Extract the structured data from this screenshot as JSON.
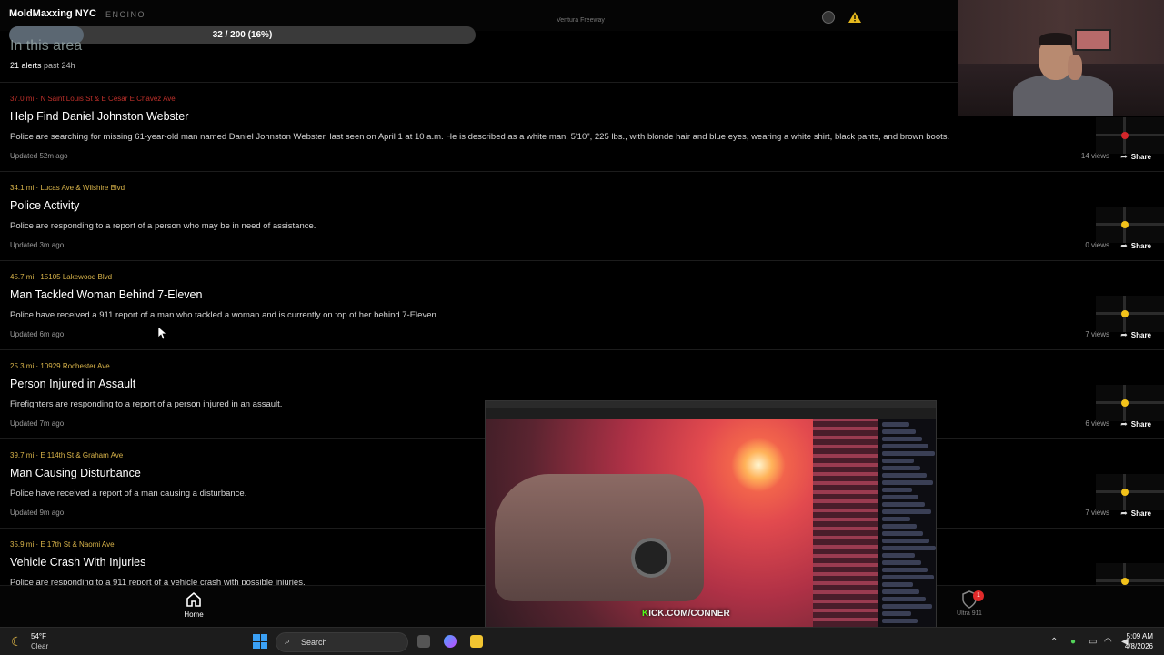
{
  "stream": {
    "title": "MoldMaxxing NYC",
    "area_tag": "ENCINO",
    "freeway_label": "Ventura Freeway",
    "progress": {
      "label": "32 / 200 (16%)",
      "fraction": 0.16
    }
  },
  "header": {
    "title": "In this area",
    "alerts_count": "21 alerts",
    "alerts_window": "past 24h"
  },
  "alerts": [
    {
      "meta": "37.0 mi · N Saint Louis St & E Cesar E Chavez Ave",
      "meta_color": "#c0312b",
      "title": "Help Find Daniel Johnston Webster",
      "description": "Police are searching for missing 61-year-old man named Daniel Johnston Webster, last seen on April 1 at 10 a.m. He is described as a white man, 5'10\", 225 lbs., with blonde hair and blue eyes, wearing a white shirt, black pants, and brown boots.",
      "updated": "Updated 52m ago",
      "views": "14 views",
      "share": "Share",
      "pin_color": "#d3262b"
    },
    {
      "meta": "34.1 mi · Lucas Ave & Wilshire Blvd",
      "meta_color": "#d9b44a",
      "title": "Police Activity",
      "description": "Police are responding to a report of a person who may be in need of assistance.",
      "updated": "Updated 3m ago",
      "views": "0 views",
      "share": "Share",
      "pin_color": "#f2c21a"
    },
    {
      "meta": "45.7 mi · 15105 Lakewood Blvd",
      "meta_color": "#d9b44a",
      "title": "Man Tackled Woman Behind 7-Eleven",
      "description": "Police have received a 911 report of a man who tackled a woman and is currently on top of her behind 7-Eleven.",
      "updated": "Updated 6m ago",
      "views": "7 views",
      "share": "Share",
      "pin_color": "#f2c21a"
    },
    {
      "meta": "25.3 mi · 10929 Rochester Ave",
      "meta_color": "#d9b44a",
      "title": "Person Injured in Assault",
      "description": "Firefighters are responding to a report of a person injured in an assault.",
      "updated": "Updated 7m ago",
      "views": "6 views",
      "share": "Share",
      "pin_color": "#f2c21a"
    },
    {
      "meta": "39.7 mi · E 114th St & Graham Ave",
      "meta_color": "#d9b44a",
      "title": "Man Causing Disturbance",
      "description": "Police have received a report of a man causing a disturbance.",
      "updated": "Updated 9m ago",
      "views": "7 views",
      "share": "Share",
      "pin_color": "#f2c21a"
    },
    {
      "meta": "35.9 mi · E 17th St & Naomi Ave",
      "meta_color": "#d9b44a",
      "title": "Vehicle Crash With Injuries",
      "description": "Police are responding to a 911 report of a vehicle crash with possible injuries.",
      "updated": "",
      "views": "",
      "share": "",
      "pin_color": "#f2c21a"
    }
  ],
  "bottom_nav": {
    "home_label": "Home",
    "ultra_label": "Ultra 911",
    "ultra_badge": "1"
  },
  "video": {
    "caption_k": "K",
    "caption_rest": "ICK.COM/CONNER"
  },
  "taskbar": {
    "weather_temp": "54°F",
    "weather_desc": "Clear",
    "search_label": "Search",
    "time": "5:09 AM",
    "date": "4/8/2026"
  }
}
